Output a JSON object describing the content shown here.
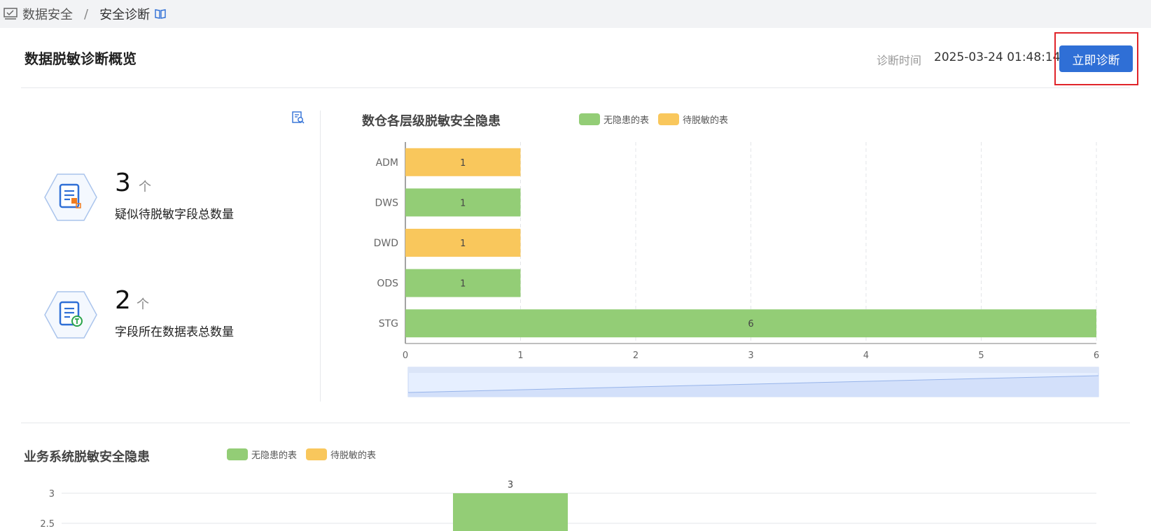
{
  "breadcrumb": {
    "section": "数据安全",
    "separator": "/",
    "current": "安全诊断"
  },
  "header": {
    "title": "数据脱敏诊断概览",
    "diagnose_time_label": "诊断时间",
    "diagnose_time_value": "2025-03-24 01:48:14",
    "diagnose_button": "立即诊断"
  },
  "stats": [
    {
      "value": "3",
      "unit": "个",
      "label": "疑似待脱敏字段总数量"
    },
    {
      "value": "2",
      "unit": "个",
      "label": "字段所在数据表总数量"
    }
  ],
  "colors": {
    "safe": "#93cd76",
    "pending": "#f9c75c",
    "accent": "#2f6fd6",
    "highlight": "#e0242a"
  },
  "chart_data": [
    {
      "type": "bar",
      "orientation": "horizontal",
      "title": "数仓各层级脱敏安全隐患",
      "legend": [
        "无隐患的表",
        "待脱敏的表"
      ],
      "categories": [
        "ADM",
        "DWS",
        "DWD",
        "ODS",
        "STG"
      ],
      "series": [
        {
          "name": "无隐患的表",
          "values": [
            0,
            1,
            0,
            1,
            6
          ]
        },
        {
          "name": "待脱敏的表",
          "values": [
            1,
            0,
            1,
            0,
            0
          ]
        }
      ],
      "data_labels": [
        "1",
        "1",
        "1",
        "1",
        "6"
      ],
      "xlim": [
        0,
        6
      ],
      "x_ticks": [
        "0",
        "1",
        "2",
        "3",
        "4",
        "5",
        "6"
      ],
      "grid": "vertical-dashed",
      "legend_position": "top"
    },
    {
      "type": "bar",
      "orientation": "vertical",
      "title": "业务系统脱敏安全隐患",
      "legend": [
        "无隐患的表",
        "待脱敏的表"
      ],
      "series": [
        {
          "name": "无隐患的表",
          "values": [
            3
          ]
        }
      ],
      "data_labels": [
        "3"
      ],
      "y_ticks": [
        "3",
        "2.5"
      ],
      "grid": "horizontal",
      "legend_position": "top"
    }
  ]
}
